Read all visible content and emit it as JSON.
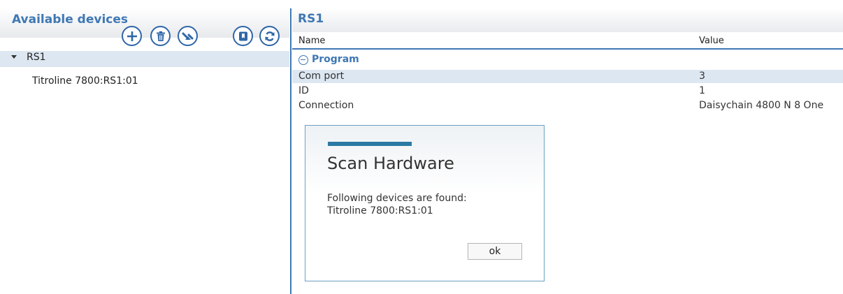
{
  "devices_panel": {
    "title": "Available devices",
    "toolbar": {
      "add": "add-icon",
      "delete": "trash-icon",
      "scan": "scan-icon",
      "bookmark": "bookmark-icon",
      "refresh": "refresh-icon"
    },
    "tree": {
      "root_label": "RS1",
      "child_label": "Titroline 7800:RS1:01"
    }
  },
  "properties_panel": {
    "title": "RS1",
    "columns": {
      "name": "Name",
      "value": "Value"
    },
    "group": {
      "label": "Program"
    },
    "rows": [
      {
        "name": "Com port",
        "value": "3"
      },
      {
        "name": "ID",
        "value": "1"
      },
      {
        "name": "Connection",
        "value": "Daisychain 4800 N 8 One"
      }
    ]
  },
  "dialog": {
    "title": "Scan Hardware",
    "message_line1": "Following devices are found:",
    "message_line2": "Titroline 7800:RS1:01",
    "ok_label": "ok"
  },
  "colors": {
    "accent": "#3f78b3",
    "selection": "#dde7f1",
    "dialog_bar": "#2a7aa3"
  }
}
